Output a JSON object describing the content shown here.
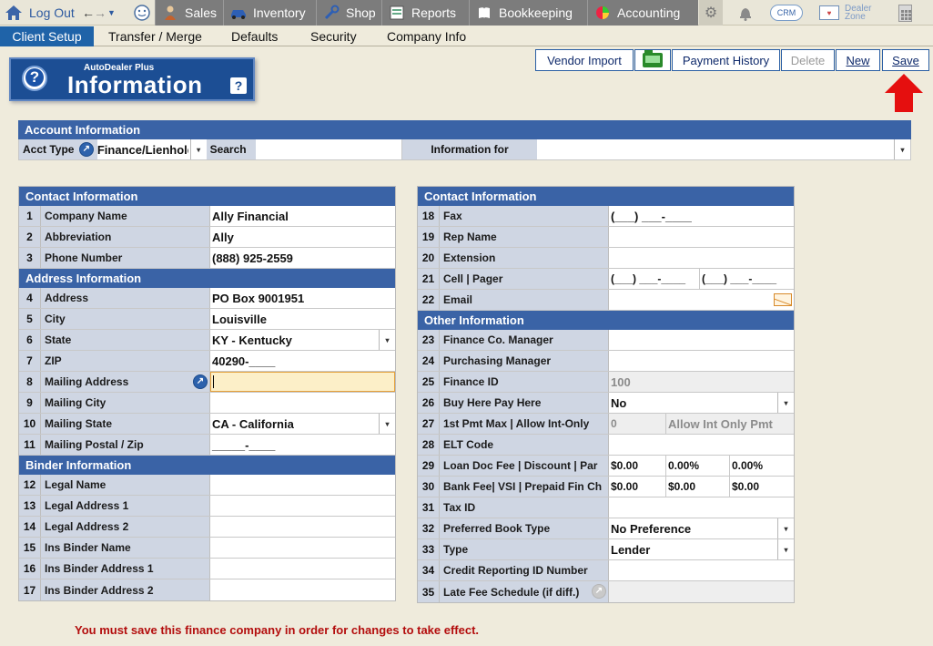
{
  "topnav": {
    "logout_label": "Log Out",
    "tabs": [
      {
        "label": "Sales",
        "icon": "sales-person-icon"
      },
      {
        "label": "Inventory",
        "icon": "car-icon"
      },
      {
        "label": "Shop",
        "icon": "wrench-icon"
      },
      {
        "label": "Reports",
        "icon": "report-icon"
      },
      {
        "label": "Bookkeeping",
        "icon": "book-icon"
      },
      {
        "label": "Accounting",
        "icon": "pie-chart-icon"
      }
    ],
    "crm_label": "CRM",
    "dealer_zone_label": "Dealer Zone"
  },
  "subnav": {
    "tabs": [
      "Client Setup",
      "Transfer / Merge",
      "Defaults",
      "Security",
      "Company Info"
    ],
    "active": "Client Setup"
  },
  "header": {
    "brand": "AutoDealer Plus",
    "title": "Information",
    "help": "?"
  },
  "toolbar": {
    "vendor_import": "Vendor Import",
    "payment_history": "Payment History",
    "delete": "Delete",
    "new": "New",
    "save": "Save"
  },
  "account": {
    "heading": "Account Information",
    "acct_type_label": "Acct Type",
    "acct_type_value": "Finance/Lienholder",
    "search_label": "Search",
    "search_value": "",
    "info_for_label": "Information for",
    "info_for_value": ""
  },
  "left": {
    "contact_heading": "Contact Information",
    "contact_rows": [
      {
        "n": "1",
        "label": "Company Name",
        "value": "Ally Financial"
      },
      {
        "n": "2",
        "label": "Abbreviation",
        "value": "Ally"
      },
      {
        "n": "3",
        "label": "Phone Number",
        "value": "(888) 925-2559"
      }
    ],
    "address_heading": "Address Information",
    "address_rows": [
      {
        "n": "4",
        "label": "Address",
        "value": "PO Box 9001951"
      },
      {
        "n": "5",
        "label": "City",
        "value": "Louisville"
      },
      {
        "n": "6",
        "label": "State",
        "value": "KY - Kentucky"
      },
      {
        "n": "7",
        "label": "ZIP",
        "value": "40290-____"
      },
      {
        "n": "8",
        "label": "Mailing Address",
        "value": ""
      },
      {
        "n": "9",
        "label": "Mailing City",
        "value": ""
      },
      {
        "n": "10",
        "label": "Mailing State",
        "value": "CA - California"
      },
      {
        "n": "11",
        "label": "Mailing Postal / Zip",
        "value": "_____-____"
      }
    ],
    "binder_heading": "Binder Information",
    "binder_rows": [
      {
        "n": "12",
        "label": "Legal Name",
        "value": ""
      },
      {
        "n": "13",
        "label": "Legal Address 1",
        "value": ""
      },
      {
        "n": "14",
        "label": "Legal Address 2",
        "value": ""
      },
      {
        "n": "15",
        "label": "Ins Binder Name",
        "value": ""
      },
      {
        "n": "16",
        "label": "Ins Binder Address 1",
        "value": ""
      },
      {
        "n": "17",
        "label": "Ins Binder Address 2",
        "value": ""
      }
    ]
  },
  "right": {
    "contact_heading": "Contact Information",
    "contact_rows": [
      {
        "n": "18",
        "label": "Fax",
        "value": "(___) ___-____"
      },
      {
        "n": "19",
        "label": "Rep Name",
        "value": ""
      },
      {
        "n": "20",
        "label": "Extension",
        "value": ""
      },
      {
        "n": "21",
        "label": "Cell | Pager",
        "value": "(___) ___-____",
        "value2": "(___) ___-____"
      },
      {
        "n": "22",
        "label": "Email",
        "value": ""
      }
    ],
    "other_heading": "Other Information",
    "other_rows": [
      {
        "n": "23",
        "label": "Finance Co. Manager",
        "value": ""
      },
      {
        "n": "24",
        "label": "Purchasing Manager",
        "value": ""
      },
      {
        "n": "25",
        "label": "Finance ID",
        "value": "100"
      },
      {
        "n": "26",
        "label": "Buy Here Pay Here",
        "value": "No"
      },
      {
        "n": "27",
        "label": "1st Pmt Max | Allow Int-Only",
        "value": "0",
        "value2": "Allow Int Only Pmt"
      },
      {
        "n": "28",
        "label": "ELT Code",
        "value": ""
      },
      {
        "n": "29",
        "label": "Loan Doc Fee | Discount | Par",
        "value": "$0.00",
        "value2": "0.00%",
        "value3": "0.00%"
      },
      {
        "n": "30",
        "label": "Bank Fee| VSI | Prepaid Fin Ch",
        "value": "$0.00",
        "value2": "$0.00",
        "value3": "$0.00"
      },
      {
        "n": "31",
        "label": "Tax ID",
        "value": ""
      },
      {
        "n": "32",
        "label": "Preferred Book Type",
        "value": "No Preference"
      },
      {
        "n": "33",
        "label": "Type",
        "value": "Lender"
      },
      {
        "n": "34",
        "label": "Credit Reporting ID Number",
        "value": ""
      },
      {
        "n": "35",
        "label": "Late Fee Schedule (if diff.)",
        "value": ""
      }
    ]
  },
  "footer_message": "You must save this finance company in order for changes to take effect."
}
